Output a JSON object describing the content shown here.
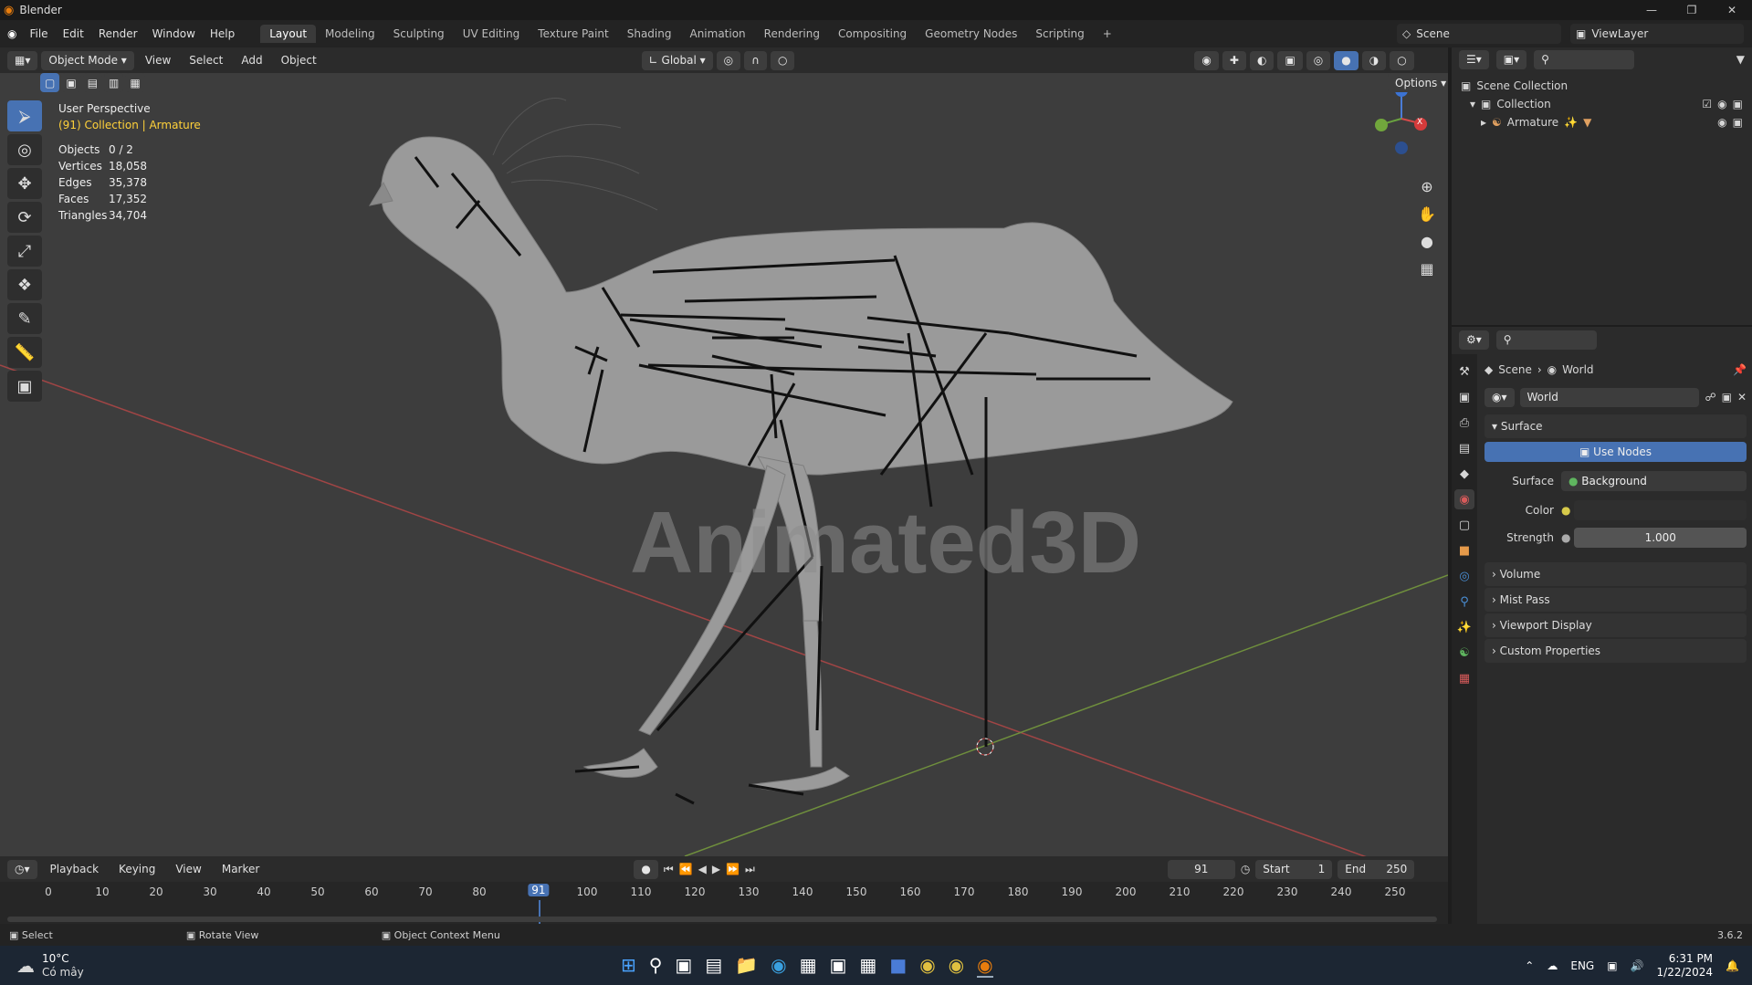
{
  "app": {
    "title": "Blender",
    "version": "3.6.2"
  },
  "window_controls": [
    "—",
    "❐",
    "✕"
  ],
  "menu": [
    "File",
    "Edit",
    "Render",
    "Window",
    "Help"
  ],
  "workspaces": [
    "Layout",
    "Modeling",
    "Sculpting",
    "UV Editing",
    "Texture Paint",
    "Shading",
    "Animation",
    "Rendering",
    "Compositing",
    "Geometry Nodes",
    "Scripting"
  ],
  "active_workspace": "Layout",
  "scene_name": "Scene",
  "view_layer": "ViewLayer",
  "viewport_header": {
    "mode": "Object Mode",
    "menus": [
      "View",
      "Select",
      "Add",
      "Object"
    ],
    "orientation": "Global",
    "options_label": "Options"
  },
  "viewport": {
    "perspective": "User Perspective",
    "collection_info": "(91) Collection | Armature",
    "stats": [
      {
        "label": "Objects",
        "value": "0 / 2"
      },
      {
        "label": "Vertices",
        "value": "18,058"
      },
      {
        "label": "Edges",
        "value": "35,378"
      },
      {
        "label": "Faces",
        "value": "17,352"
      },
      {
        "label": "Triangles",
        "value": "34,704"
      }
    ],
    "watermark": "Animated3D",
    "gizmo_axes": {
      "z": "Z",
      "x": "X"
    }
  },
  "outliner": {
    "items": [
      {
        "label": "Scene Collection",
        "level": 0
      },
      {
        "label": "Collection",
        "level": 1
      },
      {
        "label": "Armature",
        "level": 2
      }
    ]
  },
  "properties": {
    "breadcrumb": [
      "Scene",
      "World"
    ],
    "world_name": "World",
    "surface_section": "Surface",
    "use_nodes": "Use Nodes",
    "surface_label": "Surface",
    "surface_value": "Background",
    "color_label": "Color",
    "strength_label": "Strength",
    "strength_value": "1.000",
    "collapsed_sections": [
      "Volume",
      "Mist Pass",
      "Viewport Display",
      "Custom Properties"
    ]
  },
  "timeline": {
    "menus": [
      "Playback",
      "Keying",
      "View",
      "Marker"
    ],
    "current_frame": "91",
    "start_label": "Start",
    "start_value": "1",
    "end_label": "End",
    "end_value": "250",
    "ticks": [
      "0",
      "10",
      "20",
      "30",
      "40",
      "50",
      "60",
      "70",
      "80",
      "91",
      "100",
      "110",
      "120",
      "130",
      "140",
      "150",
      "160",
      "170",
      "180",
      "190",
      "200",
      "210",
      "220",
      "230",
      "240",
      "250"
    ]
  },
  "statusbar": {
    "select": "Select",
    "rotate": "Rotate View",
    "context": "Object Context Menu",
    "version": "3.6.2"
  },
  "taskbar": {
    "temperature": "10°C",
    "weather": "Có mây",
    "lang": "ENG",
    "time": "6:31 PM",
    "date": "1/22/2024"
  },
  "colors": {
    "accent": "#4772b3",
    "collection_text": "#ffd13a",
    "x_axis": "#c74848",
    "y_axis": "#7fa94a"
  }
}
